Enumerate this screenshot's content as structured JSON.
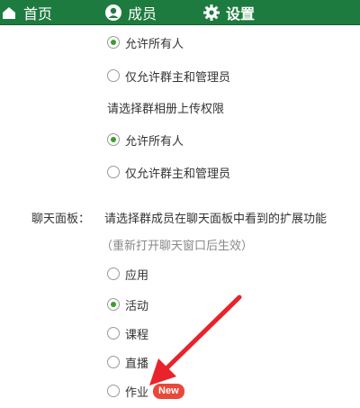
{
  "nav": {
    "home": "首页",
    "members": "成员",
    "settings": "设置"
  },
  "share_options": [
    {
      "label": "允许所有人",
      "checked": true
    },
    {
      "label": "仅允许群主和管理员",
      "checked": false
    }
  ],
  "album_prompt": "请选择群相册上传权限",
  "album_options": [
    {
      "label": "允许所有人",
      "checked": true
    },
    {
      "label": "仅允许群主和管理员",
      "checked": false
    }
  ],
  "chat_panel": {
    "label": "聊天面板：",
    "prompt": "请选择群成员在聊天面板中看到的扩展功能",
    "hint": "（重新打开聊天窗口后生效）",
    "options": [
      {
        "label": "应用",
        "checked": false
      },
      {
        "label": "活动",
        "checked": true
      },
      {
        "label": "课程",
        "checked": false
      },
      {
        "label": "直播",
        "checked": false
      },
      {
        "label": "作业",
        "checked": false,
        "badge": "New"
      }
    ]
  },
  "colors": {
    "nav_bg": "#1e7b3f",
    "radio_checked": "#3a9e2a",
    "badge": "#e8483a",
    "annotation_arrow": "#e8232b"
  }
}
